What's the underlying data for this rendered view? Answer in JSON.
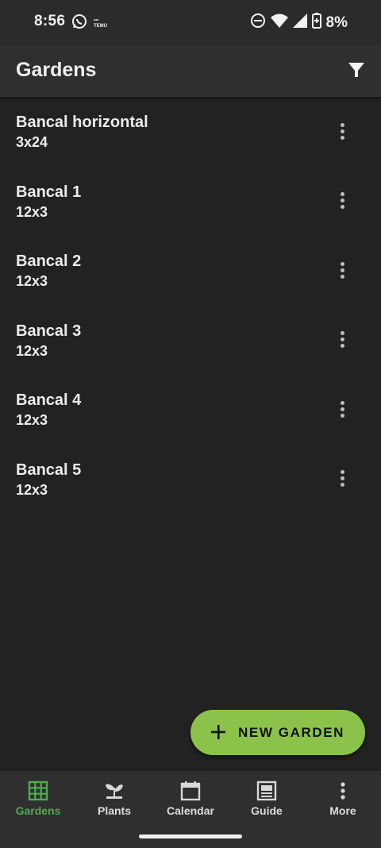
{
  "status_bar": {
    "time": "8:56",
    "notif_temu_line1": "&#x2022;&#x2022;&#x2022;",
    "notif_temu_label": "TEMU",
    "battery_percent": "8%",
    "icons": [
      "whatsapp-icon",
      "temu-icon",
      "do-not-disturb-icon",
      "wifi-icon",
      "signal-icon",
      "battery-icon"
    ]
  },
  "app_bar": {
    "title": "Gardens",
    "filter_icon": "filter-icon"
  },
  "gardens": [
    {
      "name": "Bancal horizontal",
      "size": "3x24"
    },
    {
      "name": "Bancal 1",
      "size": "12x3"
    },
    {
      "name": "Bancal 2",
      "size": "12x3"
    },
    {
      "name": "Bancal 3",
      "size": "12x3"
    },
    {
      "name": "Bancal 4",
      "size": "12x3"
    },
    {
      "name": "Bancal 5",
      "size": "12x3"
    }
  ],
  "fab": {
    "label": "NEW GARDEN",
    "icon": "plus-icon"
  },
  "bottom_nav": {
    "items": [
      {
        "label": "Gardens",
        "icon": "grid-icon",
        "active": true
      },
      {
        "label": "Plants",
        "icon": "sprout-icon",
        "active": false
      },
      {
        "label": "Calendar",
        "icon": "calendar-icon",
        "active": false
      },
      {
        "label": "Guide",
        "icon": "guide-icon",
        "active": false
      },
      {
        "label": "More",
        "icon": "more-vertical-icon",
        "active": false
      }
    ]
  },
  "colors": {
    "accent": "#8bc34a",
    "active_nav": "#4caf50",
    "background": "#222222",
    "app_bar": "#2f2f2f"
  }
}
